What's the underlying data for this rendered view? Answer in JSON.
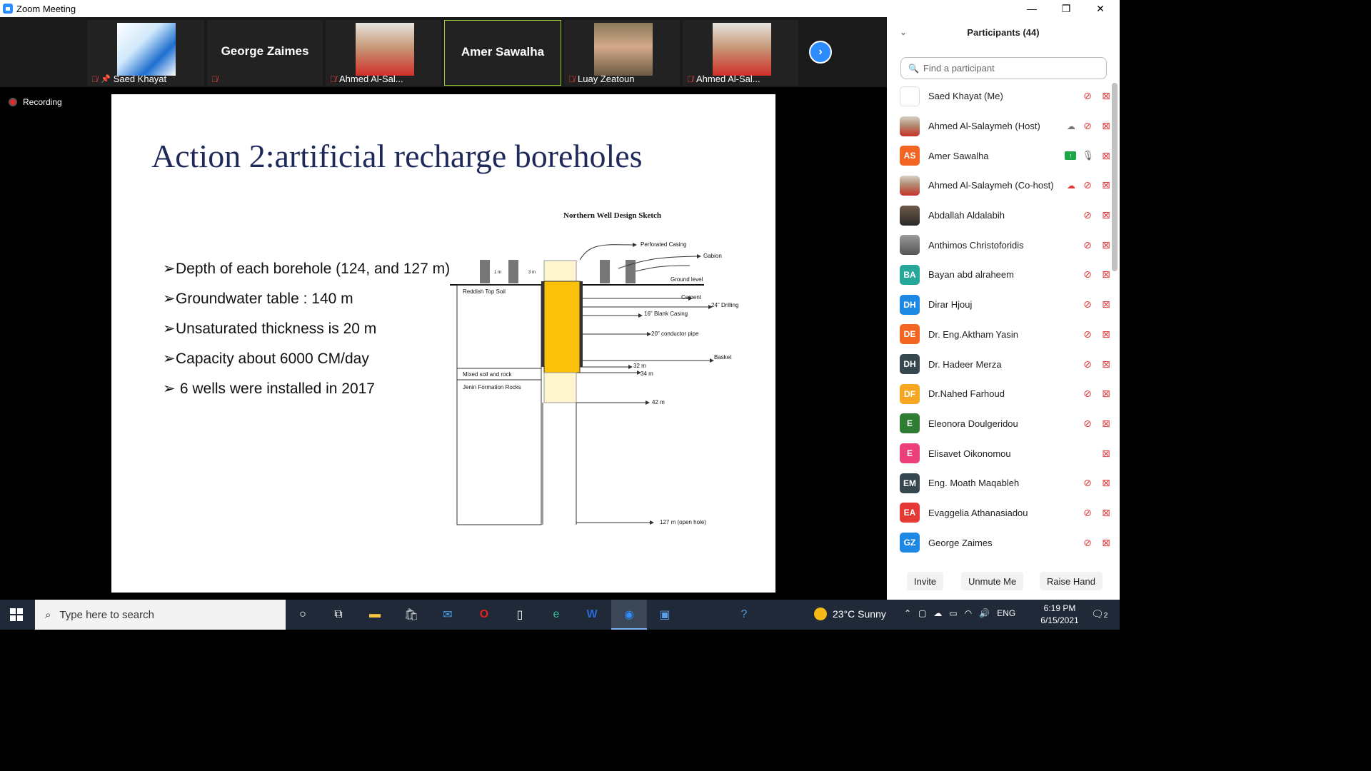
{
  "window": {
    "title": "Zoom Meeting",
    "minimize": "—",
    "restore": "❐",
    "close": "✕"
  },
  "gallery": {
    "tiles": [
      {
        "name": "Saed Khayat",
        "type": "photo"
      },
      {
        "name": "George Zaimes",
        "type": "name"
      },
      {
        "name": "Ahmed Al-Sal...",
        "type": "photo"
      },
      {
        "name": "Amer Sawalha",
        "type": "name"
      },
      {
        "name": "Luay Zeatoun",
        "type": "photo"
      },
      {
        "name": "Ahmed Al-Sal...",
        "type": "photo"
      }
    ]
  },
  "recording": {
    "label": "Recording"
  },
  "slide": {
    "title": "Action 2:artificial recharge boreholes",
    "bullets": [
      "Depth of each borehole (124, and 127 m)",
      "Groundwater table : 140 m",
      "Unsaturated thickness is 20 m",
      "Capacity about 6000 CM/day",
      " 6 wells were installed in 2017"
    ],
    "sketch": {
      "title": "Northern Well Design Sketch",
      "labels": {
        "perforated": "Perforated Casing",
        "gabion": "Gabion",
        "ground": "Ground level",
        "cement": "Cement",
        "drilling": "24\" Drilling",
        "blank": "16\" Blank Casing",
        "conductor": "20\" conductor pipe",
        "basket": "Basket",
        "d32": "32 m",
        "d34": "34 m",
        "d42": "42 m",
        "d127": "127 m (open hole)",
        "topsoil": "Reddish Top Soil",
        "mixed": "Mixed soil and  rock",
        "jenin": "Jenin Formation Rocks",
        "gap1": "1 m",
        "gap3": "3 m"
      }
    }
  },
  "participants": {
    "header": "Participants (44)",
    "search_placeholder": "Find a participant",
    "list": [
      {
        "name": "Saed Khayat (Me)",
        "initials": "",
        "color": "",
        "avatar": "logo"
      },
      {
        "name": "Ahmed Al-Salaymeh (Host)",
        "initials": "",
        "color": "",
        "avatar": "photo"
      },
      {
        "name": "Amer Sawalha",
        "initials": "AS",
        "color": "#f26522",
        "avatar": "initials"
      },
      {
        "name": "Ahmed Al-Salaymeh (Co-host)",
        "initials": "",
        "color": "",
        "avatar": "photo"
      },
      {
        "name": "Abdallah Aldalabih",
        "initials": "",
        "color": "",
        "avatar": "dark"
      },
      {
        "name": "Anthimos Christoforidis",
        "initials": "",
        "color": "",
        "avatar": "grey"
      },
      {
        "name": "Bayan abd  alraheem",
        "initials": "BA",
        "color": "#27a69a",
        "avatar": "initials"
      },
      {
        "name": "Dirar Hjouj",
        "initials": "DH",
        "color": "#1e88e5",
        "avatar": "initials"
      },
      {
        "name": "Dr. Eng.Aktham Yasin",
        "initials": "DE",
        "color": "#f26522",
        "avatar": "initials"
      },
      {
        "name": "Dr. Hadeer Merza",
        "initials": "DH",
        "color": "#37474f",
        "avatar": "initials"
      },
      {
        "name": "Dr.Nahed Farhoud",
        "initials": "DF",
        "color": "#f5a623",
        "avatar": "initials"
      },
      {
        "name": "Eleonora Doulgeridou",
        "initials": "E",
        "color": "#2e7d32",
        "avatar": "initials"
      },
      {
        "name": "Elisavet Oikonomou",
        "initials": "E",
        "color": "#ec407a",
        "avatar": "initials"
      },
      {
        "name": "Eng. Moath Maqableh",
        "initials": "EM",
        "color": "#37474f",
        "avatar": "initials"
      },
      {
        "name": "Evaggelia Athanasiadou",
        "initials": "EA",
        "color": "#e53935",
        "avatar": "initials"
      },
      {
        "name": "George Zaimes",
        "initials": "GZ",
        "color": "#1e88e5",
        "avatar": "initials"
      }
    ],
    "buttons": {
      "invite": "Invite",
      "unmute": "Unmute Me",
      "raise": "Raise Hand"
    }
  },
  "taskbar": {
    "search_placeholder": "Type here to search",
    "weather": "23°C  Sunny",
    "language": "ENG",
    "time": "6:19 PM",
    "date": "6/15/2021",
    "notifications": "2"
  }
}
